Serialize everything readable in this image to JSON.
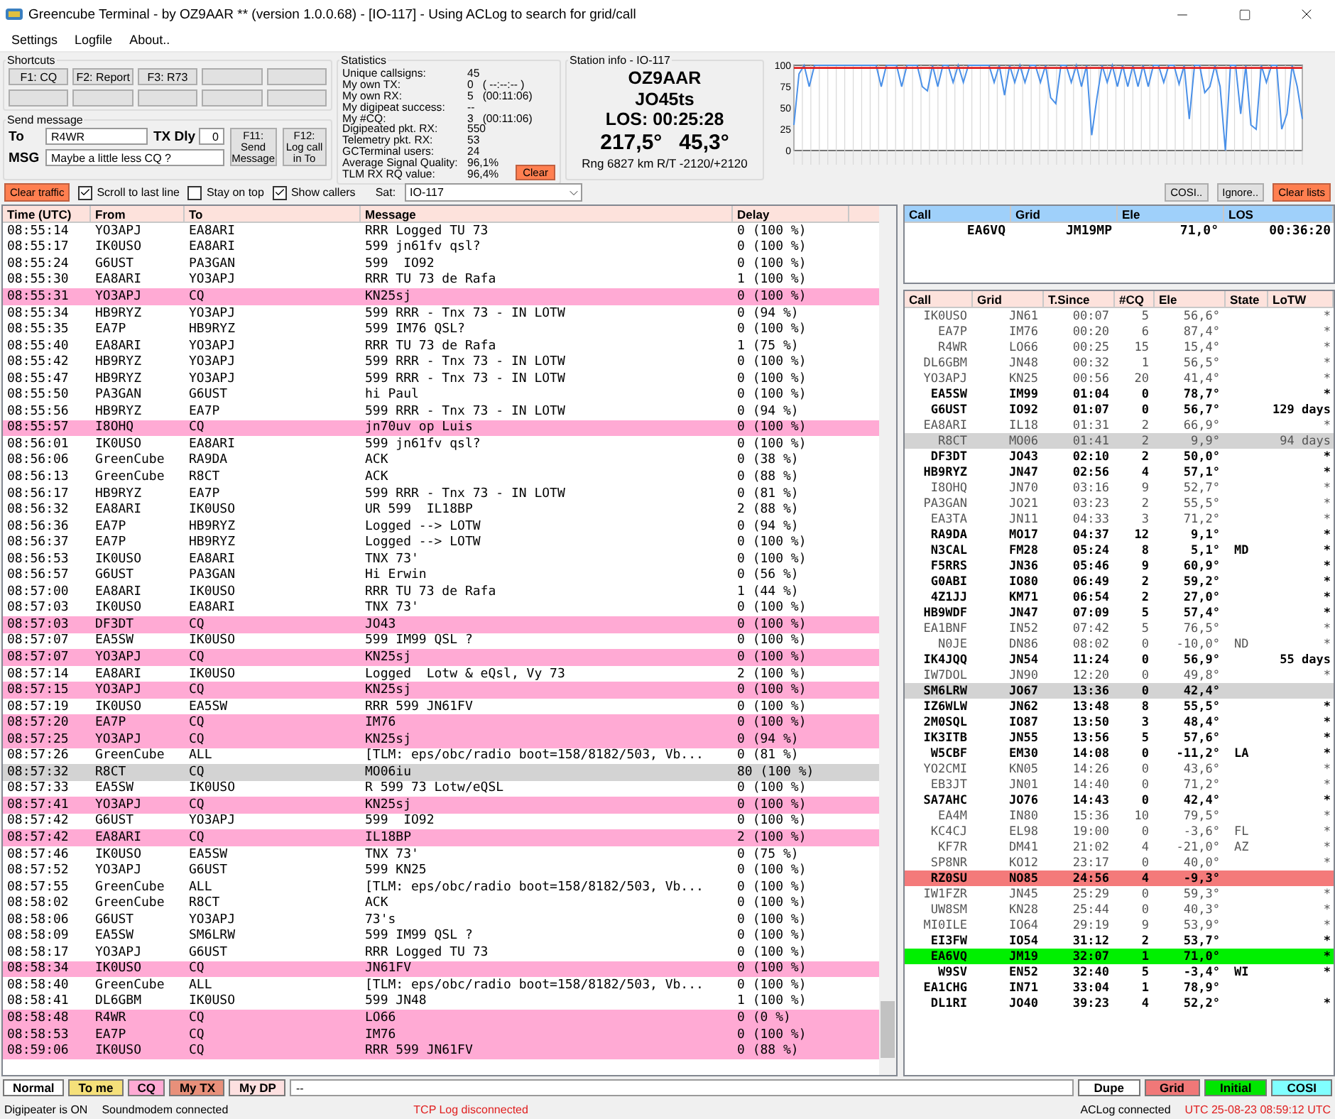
{
  "window": {
    "title": "Greencube Terminal - by OZ9AAR ** (version 1.0.0.68) - [IO-117] - Using ACLog to search for grid/call"
  },
  "menu": [
    "Settings",
    "Logfile",
    "About.."
  ],
  "shortcuts": {
    "title": "Shortcuts",
    "buttons": [
      "F1: CQ",
      "F2: Report",
      "F3: R73"
    ]
  },
  "send_message": {
    "title": "Send message",
    "to_label": "To",
    "to_value": "R4WR",
    "txdly_label": "TX Dly",
    "txdly_value": "0",
    "msg_label": "MSG",
    "msg_value": "Maybe a little less CQ ?",
    "send_button": "F11:\nSend\nMessage",
    "log_button": "F12:\nLog call\nin To"
  },
  "statistics": {
    "title": "Statistics",
    "rows": [
      {
        "label": "Unique callsigns:",
        "value": "45"
      },
      {
        "label": "My own TX:",
        "value": "0   ( --:--:-- )"
      },
      {
        "label": "My own RX:",
        "value": "5   (00:11:06)"
      },
      {
        "label": "My digipeat success:",
        "value": "--"
      },
      {
        "label": "My #CQ:",
        "value": "3   (00:11:06)"
      },
      {
        "label": "Digipeated pkt. RX:",
        "value": "550"
      },
      {
        "label": "Telemetry pkt. RX:",
        "value": "53"
      },
      {
        "label": "GCTerminal users:",
        "value": "24"
      },
      {
        "label": "Average Signal Quality:",
        "value": "96,1%"
      },
      {
        "label": "TLM RX RQ value:",
        "value": "96,4%"
      }
    ],
    "clear_button": "Clear"
  },
  "station_info": {
    "title": "Station info - IO-117",
    "call": "OZ9AAR",
    "grid": "JO45ts",
    "los": "LOS: 00:25:28",
    "azimuth": "217,5°",
    "elevation": "45,3°",
    "range": "Rng 6827 km R/T -2120/+2120"
  },
  "signal_chart": {
    "chart_data": {
      "type": "line",
      "grid": true,
      "ylim": [
        0,
        100
      ],
      "yticks": [
        0,
        25,
        50,
        75,
        100
      ],
      "series": [
        {
          "color": "#4a90e8",
          "values": [
            30,
            90,
            100,
            75,
            100,
            100,
            100,
            100,
            100,
            100,
            100,
            100,
            100,
            100,
            100,
            100,
            100,
            75,
            100,
            100,
            100,
            75,
            100,
            100,
            100,
            75,
            70,
            100,
            75,
            100,
            100,
            80,
            100,
            80,
            100,
            100,
            100,
            100,
            100,
            80,
            100,
            65,
            100,
            80,
            100,
            80,
            100,
            100,
            80,
            100,
            62,
            55,
            100,
            100,
            80,
            100,
            75,
            100,
            18,
            62,
            100,
            80,
            100,
            75,
            100,
            75,
            100,
            75,
            100,
            75,
            100,
            100,
            80,
            100,
            100,
            78,
            100,
            37,
            100,
            100,
            68,
            75,
            100,
            75,
            0,
            100,
            100,
            43,
            100,
            30,
            25,
            100,
            80,
            100,
            100,
            25,
            43,
            100,
            75,
            37
          ]
        },
        {
          "color": "#e02020",
          "values": [
            97,
            97,
            97,
            97,
            97,
            97,
            97,
            97,
            97,
            97,
            97,
            97,
            97,
            97,
            97,
            97,
            97,
            97,
            97,
            97,
            97,
            97,
            97,
            97,
            97,
            97,
            97,
            97,
            97,
            97,
            97,
            97,
            97,
            97,
            97,
            97,
            97,
            97,
            97,
            97,
            97,
            97,
            97,
            97,
            97,
            97,
            97,
            97,
            97,
            97,
            97,
            97,
            97,
            97,
            97,
            97,
            97,
            97,
            97,
            97,
            97,
            97,
            97,
            97,
            97,
            97,
            97,
            97,
            97,
            97,
            97,
            97,
            97,
            97,
            97,
            97,
            97,
            97,
            97,
            97,
            97,
            97,
            97,
            97,
            97,
            97,
            97,
            97,
            97,
            97,
            97,
            97,
            97,
            97,
            97,
            97,
            97,
            97,
            97,
            97
          ]
        }
      ]
    }
  },
  "controls": {
    "clear_traffic": "Clear traffic",
    "checkboxes": [
      {
        "label": "Scroll to last line",
        "checked": true
      },
      {
        "label": "Stay on top",
        "checked": false
      },
      {
        "label": "Show callers",
        "checked": true
      }
    ],
    "sat_label": "Sat:",
    "sat_value": "IO-117",
    "right_buttons": [
      {
        "label": "COSI..",
        "kind": "plain"
      },
      {
        "label": "Ignore..",
        "kind": "plain"
      },
      {
        "label": "Clear lists",
        "kind": "alert"
      }
    ]
  },
  "traffic": {
    "columns": [
      "Time (UTC)",
      "From",
      "To",
      "Message",
      "Delay"
    ],
    "rows": [
      {
        "time": "08:55:14",
        "from": "YO3APJ",
        "to": "EA8ARI",
        "message": "RRR Logged TU 73",
        "delay": "0 (100 %)",
        "kind": "normal"
      },
      {
        "time": "08:55:17",
        "from": "IK0USO",
        "to": "EA8ARI",
        "message": "599 jn61fv qsl?",
        "delay": "0 (100 %)",
        "kind": "normal"
      },
      {
        "time": "08:55:24",
        "from": "G6UST",
        "to": "PA3GAN",
        "message": "599  IO92",
        "delay": "0 (100 %)",
        "kind": "normal"
      },
      {
        "time": "08:55:30",
        "from": "EA8ARI",
        "to": "YO3APJ",
        "message": "RRR TU 73 de Rafa",
        "delay": "1 (100 %)",
        "kind": "normal"
      },
      {
        "time": "08:55:31",
        "from": "YO3APJ",
        "to": "CQ",
        "message": "KN25sj",
        "delay": "0 (100 %)",
        "kind": "cq"
      },
      {
        "time": "08:55:34",
        "from": "HB9RYZ",
        "to": "YO3APJ",
        "message": "599 RRR - Tnx 73 - IN LOTW",
        "delay": "0 (94 %)",
        "kind": "normal"
      },
      {
        "time": "08:55:35",
        "from": "EA7P",
        "to": "HB9RYZ",
        "message": "599 IM76 QSL?",
        "delay": "0 (100 %)",
        "kind": "normal"
      },
      {
        "time": "08:55:40",
        "from": "EA8ARI",
        "to": "YO3APJ",
        "message": "RRR TU 73 de Rafa",
        "delay": "1 (75 %)",
        "kind": "normal"
      },
      {
        "time": "08:55:42",
        "from": "HB9RYZ",
        "to": "YO3APJ",
        "message": "599 RRR - Tnx 73 - IN LOTW",
        "delay": "0 (100 %)",
        "kind": "normal"
      },
      {
        "time": "08:55:47",
        "from": "HB9RYZ",
        "to": "YO3APJ",
        "message": "599 RRR - Tnx 73 - IN LOTW",
        "delay": "0 (100 %)",
        "kind": "normal"
      },
      {
        "time": "08:55:50",
        "from": "PA3GAN",
        "to": "G6UST",
        "message": "hi Paul",
        "delay": "0 (100 %)",
        "kind": "normal"
      },
      {
        "time": "08:55:56",
        "from": "HB9RYZ",
        "to": "EA7P",
        "message": "599 RRR - Tnx 73 - IN LOTW",
        "delay": "0 (94 %)",
        "kind": "normal"
      },
      {
        "time": "08:55:57",
        "from": "I8OHQ",
        "to": "CQ",
        "message": "jn70uv op Luis",
        "delay": "0 (100 %)",
        "kind": "cq"
      },
      {
        "time": "08:56:01",
        "from": "IK0USO",
        "to": "EA8ARI",
        "message": "599 jn61fv qsl?",
        "delay": "0 (100 %)",
        "kind": "normal"
      },
      {
        "time": "08:56:06",
        "from": "GreenCube",
        "to": "RA9DA",
        "message": "ACK",
        "delay": "0 (38 %)",
        "kind": "normal"
      },
      {
        "time": "08:56:13",
        "from": "GreenCube",
        "to": "R8CT",
        "message": "ACK",
        "delay": "0 (88 %)",
        "kind": "normal"
      },
      {
        "time": "08:56:17",
        "from": "HB9RYZ",
        "to": "EA7P",
        "message": "599 RRR - Tnx 73 - IN LOTW",
        "delay": "0 (81 %)",
        "kind": "normal"
      },
      {
        "time": "08:56:32",
        "from": "EA8ARI",
        "to": "IK0USO",
        "message": "UR 599  IL18BP",
        "delay": "2 (88 %)",
        "kind": "normal"
      },
      {
        "time": "08:56:36",
        "from": "EA7P",
        "to": "HB9RYZ",
        "message": "Logged --> LOTW",
        "delay": "0 (94 %)",
        "kind": "normal"
      },
      {
        "time": "08:56:37",
        "from": "EA7P",
        "to": "HB9RYZ",
        "message": "Logged --> LOTW",
        "delay": "0 (100 %)",
        "kind": "normal"
      },
      {
        "time": "08:56:53",
        "from": "IK0USO",
        "to": "EA8ARI",
        "message": "TNX 73'",
        "delay": "0 (100 %)",
        "kind": "normal"
      },
      {
        "time": "08:56:57",
        "from": "G6UST",
        "to": "PA3GAN",
        "message": "Hi Erwin",
        "delay": "0 (56 %)",
        "kind": "normal"
      },
      {
        "time": "08:57:00",
        "from": "EA8ARI",
        "to": "IK0USO",
        "message": "RRR TU 73 de Rafa",
        "delay": "1 (44 %)",
        "kind": "normal"
      },
      {
        "time": "08:57:03",
        "from": "IK0USO",
        "to": "EA8ARI",
        "message": "TNX 73'",
        "delay": "0 (100 %)",
        "kind": "normal"
      },
      {
        "time": "08:57:03",
        "from": "DF3DT",
        "to": "CQ",
        "message": "JO43",
        "delay": "0 (100 %)",
        "kind": "cq"
      },
      {
        "time": "08:57:07",
        "from": "EA5SW",
        "to": "IK0USO",
        "message": "599 IM99 QSL ?",
        "delay": "0 (100 %)",
        "kind": "normal"
      },
      {
        "time": "08:57:07",
        "from": "YO3APJ",
        "to": "CQ",
        "message": "KN25sj",
        "delay": "0 (100 %)",
        "kind": "cq"
      },
      {
        "time": "08:57:14",
        "from": "EA8ARI",
        "to": "IK0USO",
        "message": "Logged  Lotw & eQsl, Vy 73",
        "delay": "2 (100 %)",
        "kind": "normal"
      },
      {
        "time": "08:57:15",
        "from": "YO3APJ",
        "to": "CQ",
        "message": "KN25sj",
        "delay": "0 (100 %)",
        "kind": "cq"
      },
      {
        "time": "08:57:19",
        "from": "IK0USO",
        "to": "EA5SW",
        "message": "RRR 599 JN61FV",
        "delay": "0 (100 %)",
        "kind": "normal"
      },
      {
        "time": "08:57:20",
        "from": "EA7P",
        "to": "CQ",
        "message": "IM76",
        "delay": "0 (100 %)",
        "kind": "cq"
      },
      {
        "time": "08:57:25",
        "from": "YO3APJ",
        "to": "CQ",
        "message": "KN25sj",
        "delay": "0 (94 %)",
        "kind": "cq"
      },
      {
        "time": "08:57:26",
        "from": "GreenCube",
        "to": "ALL",
        "message": "[TLM: eps/obc/radio boot=158/8182/503, Vb...",
        "delay": "0 (81 %)",
        "kind": "normal"
      },
      {
        "time": "08:57:32",
        "from": "R8CT",
        "to": "CQ",
        "message": "MO06iu",
        "delay": "80 (100 %)",
        "kind": "dupe"
      },
      {
        "time": "08:57:33",
        "from": "EA5SW",
        "to": "IK0USO",
        "message": "R 599 73 Lotw/eQSL",
        "delay": "0 (100 %)",
        "kind": "normal"
      },
      {
        "time": "08:57:41",
        "from": "YO3APJ",
        "to": "CQ",
        "message": "KN25sj",
        "delay": "0 (100 %)",
        "kind": "cq"
      },
      {
        "time": "08:57:42",
        "from": "G6UST",
        "to": "YO3APJ",
        "message": "599  IO92",
        "delay": "0 (100 %)",
        "kind": "normal"
      },
      {
        "time": "08:57:42",
        "from": "EA8ARI",
        "to": "CQ",
        "message": "IL18BP",
        "delay": "2 (100 %)",
        "kind": "cq"
      },
      {
        "time": "08:57:46",
        "from": "IK0USO",
        "to": "EA5SW",
        "message": "TNX 73'",
        "delay": "0 (75 %)",
        "kind": "normal"
      },
      {
        "time": "08:57:52",
        "from": "YO3APJ",
        "to": "G6UST",
        "message": "599 KN25",
        "delay": "0 (100 %)",
        "kind": "normal"
      },
      {
        "time": "08:57:55",
        "from": "GreenCube",
        "to": "ALL",
        "message": "[TLM: eps/obc/radio boot=158/8182/503, Vb...",
        "delay": "0 (100 %)",
        "kind": "normal"
      },
      {
        "time": "08:58:02",
        "from": "GreenCube",
        "to": "R8CT",
        "message": "ACK",
        "delay": "0 (100 %)",
        "kind": "normal"
      },
      {
        "time": "08:58:06",
        "from": "G6UST",
        "to": "YO3APJ",
        "message": "73's",
        "delay": "0 (100 %)",
        "kind": "normal"
      },
      {
        "time": "08:58:09",
        "from": "EA5SW",
        "to": "SM6LRW",
        "message": "599 IM99 QSL ?",
        "delay": "0 (100 %)",
        "kind": "normal"
      },
      {
        "time": "08:58:17",
        "from": "YO3APJ",
        "to": "G6UST",
        "message": "RRR Logged TU 73",
        "delay": "0 (100 %)",
        "kind": "normal"
      },
      {
        "time": "08:58:34",
        "from": "IK0USO",
        "to": "CQ",
        "message": "JN61FV",
        "delay": "0 (100 %)",
        "kind": "cq"
      },
      {
        "time": "08:58:40",
        "from": "GreenCube",
        "to": "ALL",
        "message": "[TLM: eps/obc/radio boot=158/8182/503, Vb...",
        "delay": "0 (100 %)",
        "kind": "normal"
      },
      {
        "time": "08:58:41",
        "from": "DL6GBM",
        "to": "IK0USO",
        "message": "599 JN48",
        "delay": "1 (100 %)",
        "kind": "normal"
      },
      {
        "time": "08:58:48",
        "from": "R4WR",
        "to": "CQ",
        "message": "LO66",
        "delay": "0 (0 %)",
        "kind": "cq"
      },
      {
        "time": "08:58:53",
        "from": "EA7P",
        "to": "CQ",
        "message": "IM76",
        "delay": "0 (100 %)",
        "kind": "cq"
      },
      {
        "time": "08:59:06",
        "from": "IK0USO",
        "to": "CQ",
        "message": "RRR 599 JN61FV",
        "delay": "0 (88 %)",
        "kind": "cq"
      }
    ]
  },
  "pass": {
    "columns": [
      "Call",
      "Grid",
      "Ele",
      "LOS"
    ],
    "rows": [
      {
        "call": "EA6VQ",
        "grid": "JM19MP",
        "ele": "71,0°",
        "los": "00:36:20"
      }
    ]
  },
  "callers": {
    "columns": [
      "Call",
      "Grid",
      "T.Since",
      "#CQ",
      "Ele",
      "State",
      "LoTW"
    ],
    "rows": [
      {
        "call": "IK0USO",
        "grid": "JN61",
        "since": "00:07",
        "cq": "5",
        "ele": "56,6°",
        "lotw": "*",
        "bold": false,
        "kind": "none"
      },
      {
        "call": "EA7P",
        "grid": "IM76",
        "since": "00:20",
        "cq": "6",
        "ele": "87,4°",
        "lotw": "*",
        "bold": false,
        "kind": "none"
      },
      {
        "call": "R4WR",
        "grid": "LO66",
        "since": "00:25",
        "cq": "15",
        "ele": "15,4°",
        "lotw": "*",
        "bold": false,
        "kind": "none"
      },
      {
        "call": "DL6GBM",
        "grid": "JN48",
        "since": "00:32",
        "cq": "1",
        "ele": "56,5°",
        "lotw": "*",
        "bold": false,
        "kind": "none"
      },
      {
        "call": "YO3APJ",
        "grid": "KN25",
        "since": "00:56",
        "cq": "20",
        "ele": "41,4°",
        "lotw": "*",
        "bold": false,
        "kind": "none"
      },
      {
        "call": "EA5SW",
        "grid": "IM99",
        "since": "01:04",
        "cq": "0",
        "ele": "78,7°",
        "lotw": "*",
        "bold": true,
        "kind": "none"
      },
      {
        "call": "G6UST",
        "grid": "IO92",
        "since": "01:07",
        "cq": "0",
        "ele": "56,7°",
        "lotw": "129 days",
        "bold": true,
        "kind": "none"
      },
      {
        "call": "EA8ARI",
        "grid": "IL18",
        "since": "01:31",
        "cq": "2",
        "ele": "66,9°",
        "lotw": "*",
        "bold": false,
        "kind": "none"
      },
      {
        "call": "R8CT",
        "grid": "MO06",
        "since": "01:41",
        "cq": "2",
        "ele": "9,9°",
        "lotw": "94 days",
        "bold": false,
        "kind": "dupe"
      },
      {
        "call": "DF3DT",
        "grid": "JO43",
        "since": "02:10",
        "cq": "2",
        "ele": "50,0°",
        "lotw": "*",
        "bold": true,
        "kind": "none"
      },
      {
        "call": "HB9RYZ",
        "grid": "JN47",
        "since": "02:56",
        "cq": "4",
        "ele": "57,1°",
        "lotw": "*",
        "bold": true,
        "kind": "none"
      },
      {
        "call": "I8OHQ",
        "grid": "JN70",
        "since": "03:16",
        "cq": "9",
        "ele": "52,7°",
        "lotw": "*",
        "bold": false,
        "kind": "none"
      },
      {
        "call": "PA3GAN",
        "grid": "JO21",
        "since": "03:23",
        "cq": "2",
        "ele": "55,5°",
        "lotw": "*",
        "bold": false,
        "kind": "none"
      },
      {
        "call": "EA3TA",
        "grid": "JN11",
        "since": "04:33",
        "cq": "3",
        "ele": "71,2°",
        "lotw": "*",
        "bold": false,
        "kind": "none"
      },
      {
        "call": "RA9DA",
        "grid": "MO17",
        "since": "04:37",
        "cq": "12",
        "ele": "9,1°",
        "lotw": "*",
        "bold": true,
        "kind": "none"
      },
      {
        "call": "N3CAL",
        "grid": "FM28",
        "since": "05:24",
        "cq": "8",
        "ele": "5,1°",
        "state": "MD",
        "lotw": "*",
        "bold": true,
        "kind": "none"
      },
      {
        "call": "F5RRS",
        "grid": "JN36",
        "since": "05:46",
        "cq": "9",
        "ele": "60,9°",
        "lotw": "*",
        "bold": true,
        "kind": "none"
      },
      {
        "call": "G0ABI",
        "grid": "IO80",
        "since": "06:49",
        "cq": "2",
        "ele": "59,2°",
        "lotw": "*",
        "bold": true,
        "kind": "none"
      },
      {
        "call": "4Z1JJ",
        "grid": "KM71",
        "since": "06:54",
        "cq": "2",
        "ele": "27,0°",
        "lotw": "*",
        "bold": true,
        "kind": "none"
      },
      {
        "call": "HB9WDF",
        "grid": "JN47",
        "since": "07:09",
        "cq": "5",
        "ele": "57,4°",
        "lotw": "*",
        "bold": true,
        "kind": "none"
      },
      {
        "call": "EA1BNF",
        "grid": "IN52",
        "since": "07:42",
        "cq": "5",
        "ele": "76,5°",
        "lotw": "*",
        "bold": false,
        "kind": "none"
      },
      {
        "call": "N0JE",
        "grid": "DN86",
        "since": "08:02",
        "cq": "0",
        "ele": "-10,0°",
        "state": "ND",
        "lotw": "*",
        "bold": false,
        "kind": "none"
      },
      {
        "call": "IK4JQQ",
        "grid": "JN54",
        "since": "11:24",
        "cq": "0",
        "ele": "56,9°",
        "lotw": "55 days",
        "bold": true,
        "kind": "none"
      },
      {
        "call": "IW7DOL",
        "grid": "JN90",
        "since": "12:20",
        "cq": "0",
        "ele": "49,8°",
        "lotw": "*",
        "bold": false,
        "kind": "none"
      },
      {
        "call": "SM6LRW",
        "grid": "JO67",
        "since": "13:36",
        "cq": "0",
        "ele": "42,4°",
        "bold": true,
        "kind": "dupe"
      },
      {
        "call": "IZ6WLW",
        "grid": "JN62",
        "since": "13:48",
        "cq": "8",
        "ele": "55,5°",
        "lotw": "*",
        "bold": true,
        "kind": "none"
      },
      {
        "call": "2M0SQL",
        "grid": "IO87",
        "since": "13:50",
        "cq": "3",
        "ele": "48,4°",
        "lotw": "*",
        "bold": true,
        "kind": "none"
      },
      {
        "call": "IK3ITB",
        "grid": "JN55",
        "since": "13:56",
        "cq": "5",
        "ele": "57,6°",
        "lotw": "*",
        "bold": true,
        "kind": "none"
      },
      {
        "call": "W5CBF",
        "grid": "EM30",
        "since": "14:08",
        "cq": "0",
        "ele": "-11,2°",
        "state": "LA",
        "lotw": "*",
        "bold": true,
        "kind": "none"
      },
      {
        "call": "YO2CMI",
        "grid": "KN05",
        "since": "14:26",
        "cq": "0",
        "ele": "43,6°",
        "lotw": "*",
        "bold": false,
        "kind": "none"
      },
      {
        "call": "EB3JT",
        "grid": "JN01",
        "since": "14:40",
        "cq": "0",
        "ele": "71,2°",
        "lotw": "*",
        "bold": false,
        "kind": "none"
      },
      {
        "call": "SA7AHC",
        "grid": "JO76",
        "since": "14:43",
        "cq": "0",
        "ele": "42,4°",
        "lotw": "*",
        "bold": true,
        "kind": "none"
      },
      {
        "call": "EA4M",
        "grid": "IN80",
        "since": "15:36",
        "cq": "10",
        "ele": "79,5°",
        "lotw": "*",
        "bold": false,
        "kind": "none"
      },
      {
        "call": "KC4CJ",
        "grid": "EL98",
        "since": "19:00",
        "cq": "0",
        "ele": "-3,6°",
        "state": "FL",
        "lotw": "*",
        "bold": false,
        "kind": "none"
      },
      {
        "call": "KF7R",
        "grid": "DM41",
        "since": "21:02",
        "cq": "4",
        "ele": "-21,0°",
        "state": "AZ",
        "lotw": "*",
        "bold": false,
        "kind": "none"
      },
      {
        "call": "SP8NR",
        "grid": "KO12",
        "since": "23:17",
        "cq": "0",
        "ele": "40,0°",
        "lotw": "*",
        "bold": false,
        "kind": "none"
      },
      {
        "call": "RZ0SU",
        "grid": "NO85",
        "since": "24:56",
        "cq": "4",
        "ele": "-9,3°",
        "bold": true,
        "kind": "grid"
      },
      {
        "call": "IW1FZR",
        "grid": "JN45",
        "since": "25:29",
        "cq": "0",
        "ele": "59,3°",
        "lotw": "*",
        "bold": false,
        "kind": "none"
      },
      {
        "call": "UW8SM",
        "grid": "KN28",
        "since": "25:44",
        "cq": "0",
        "ele": "40,3°",
        "lotw": "*",
        "bold": false,
        "kind": "none"
      },
      {
        "call": "MI0ILE",
        "grid": "IO64",
        "since": "29:19",
        "cq": "9",
        "ele": "53,9°",
        "lotw": "*",
        "bold": false,
        "kind": "none"
      },
      {
        "call": "EI3FW",
        "grid": "IO54",
        "since": "31:12",
        "cq": "2",
        "ele": "53,7°",
        "lotw": "*",
        "bold": true,
        "kind": "none"
      },
      {
        "call": "EA6VQ",
        "grid": "JM19",
        "since": "32:07",
        "cq": "1",
        "ele": "71,0°",
        "lotw": "*",
        "bold": true,
        "kind": "initial"
      },
      {
        "call": "W9SV",
        "grid": "EN52",
        "since": "32:40",
        "cq": "5",
        "ele": "-3,4°",
        "state": "WI",
        "lotw": "*",
        "bold": true,
        "kind": "none"
      },
      {
        "call": "EA1CHG",
        "grid": "IN71",
        "since": "33:04",
        "cq": "1",
        "ele": "78,9°",
        "bold": true,
        "kind": "none"
      },
      {
        "call": "DL1RI",
        "grid": "JO40",
        "since": "39:23",
        "cq": "4",
        "ele": "52,2°",
        "lotw": "*",
        "bold": true,
        "kind": "none"
      }
    ]
  },
  "legend_left": [
    {
      "label": "Normal",
      "color": "#ffffff"
    },
    {
      "label": "To me",
      "color": "#f5e07a"
    },
    {
      "label": "CQ",
      "color": "#ffaad4"
    },
    {
      "label": "My TX",
      "color": "#e8907a"
    },
    {
      "label": "My DP",
      "color": "#fde0e0"
    }
  ],
  "filter_value": "--",
  "legend_right": [
    {
      "label": "Dupe",
      "color": "#ffffff"
    },
    {
      "label": "Grid",
      "color": "#f07878"
    },
    {
      "label": "Initial",
      "color": "#00e600"
    },
    {
      "label": "COSI",
      "color": "#80ffff"
    }
  ],
  "status_bar": [
    {
      "text": "Digipeater is ON",
      "alert": false
    },
    {
      "text": "Soundmodem connected",
      "alert": false
    },
    {
      "text": "TCP Log disconnected",
      "alert": true
    },
    {
      "text": "ACLog connected",
      "alert": false
    },
    {
      "text": "UTC 25-08-23 08:59:12 UTC",
      "alert": true
    }
  ]
}
